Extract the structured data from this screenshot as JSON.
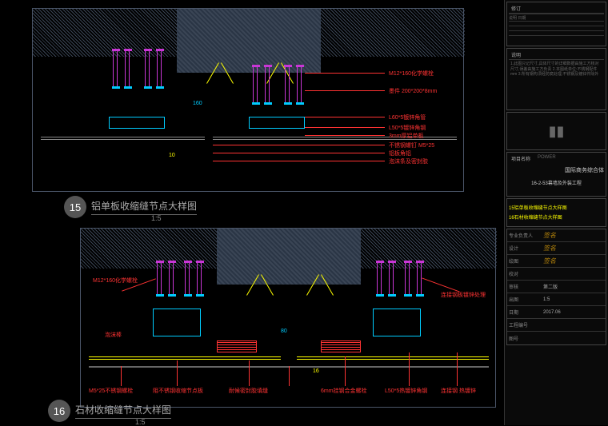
{
  "detail15": {
    "number": "15",
    "title": "铝单板收缩缝节点大样图",
    "scale": "1:5",
    "dim_h": "160",
    "dim_v": "10",
    "labels": {
      "l1": "M12*160化学螺栓",
      "l2": "墨件 200*200*8mm",
      "l3": "L60*5镀锌角管",
      "l4": "L50*5镀锌角钢",
      "l5": "3mm厚铝单板",
      "l6": "不锈钢螺钉 M5*25",
      "l7": "铝板角铝",
      "l8": "泡沫条及密封胶"
    }
  },
  "detail16": {
    "number": "16",
    "title": "石材收缩缝节点大样图",
    "scale": "1:5",
    "dim_h": "80",
    "dim_v": "16",
    "labels": {
      "l1": "M12*160化学螺栓",
      "l2": "连接钢板镀锌处理",
      "l3": "泡沫棒",
      "l4": "M5*25不锈钢螺栓",
      "l5": "阻不锈钢收缩节点板",
      "l6": "耐候密封胶填缝",
      "l7": "6mm挂钢合金螺栓",
      "l8": "L50*5热镀锌角钢",
      "l9": "连接钢 热镀锌"
    }
  },
  "titleblock": {
    "header": "修订",
    "rev_cols": "说明 日期",
    "notes_title": "说明",
    "notes": "1.此图只记尺寸,具体尺寸的详细数据由施工方核对\n尺寸,误差由施工方负责\n2.本图纸单位:不锈钢配件mm\n3.所有钢构须经防腐处理,不锈钢及镀锌件除外",
    "logo": "▮▮",
    "project_label": "项目名称",
    "project_name": "POWER",
    "project_title": "国际商务综合体",
    "project_code": "16-2-53幕墙及外装工程",
    "drawing_titles": {
      "t1": "15铝单板收缩缝节点大样图",
      "t2": "16石材收缩缝节点大样图"
    },
    "rows": {
      "r1_label": "专业负责人",
      "r2_label": "设计",
      "r3_label": "绘图",
      "r4_label": "校对",
      "r5_label": "审核",
      "r5_val": "第二版",
      "r6_label": "出图",
      "r6_val": "1:5",
      "r7_label": "日期",
      "r7_val": "2017.06",
      "r8_label": "工程编号",
      "r9_label": "图号"
    }
  }
}
